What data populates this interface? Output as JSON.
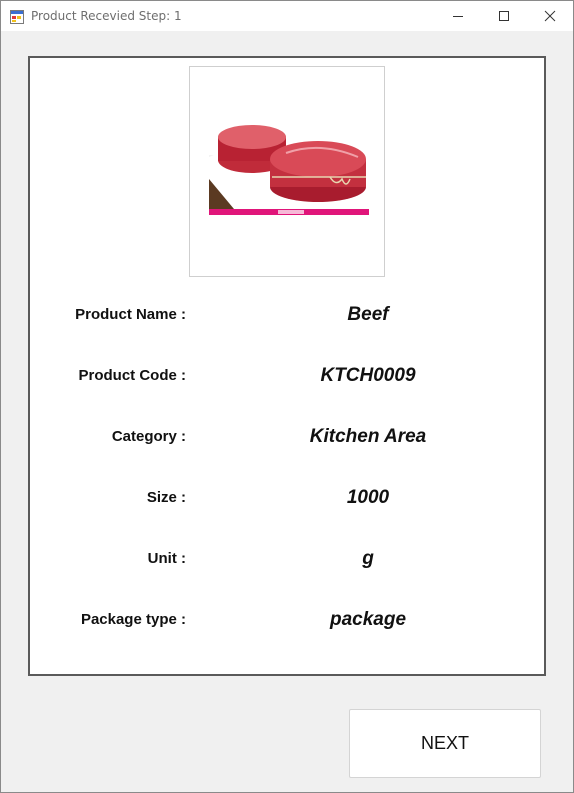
{
  "window": {
    "title": "Product Recevied Step: 1",
    "app_icon": "form-icon",
    "controls": {
      "minimize": "minimize-icon",
      "maximize": "maximize-icon",
      "close": "close-icon"
    }
  },
  "product": {
    "image": {
      "subject": "raw beef fillet steaks tied with twine",
      "icon": "product-photo"
    },
    "fields": [
      {
        "label": "Product Name :",
        "value": "Beef"
      },
      {
        "label": "Product Code :",
        "value": "KTCH0009"
      },
      {
        "label": "Category :",
        "value": "Kitchen Area"
      },
      {
        "label": "Size :",
        "value": "1000"
      },
      {
        "label": "Unit :",
        "value": "g"
      },
      {
        "label": "Package type :",
        "value": "package"
      }
    ]
  },
  "actions": {
    "next_label": "NEXT"
  },
  "colors": {
    "accent_bar": "#e0157a",
    "panel_border": "#5a5a5a",
    "background": "#f0f0f0"
  }
}
